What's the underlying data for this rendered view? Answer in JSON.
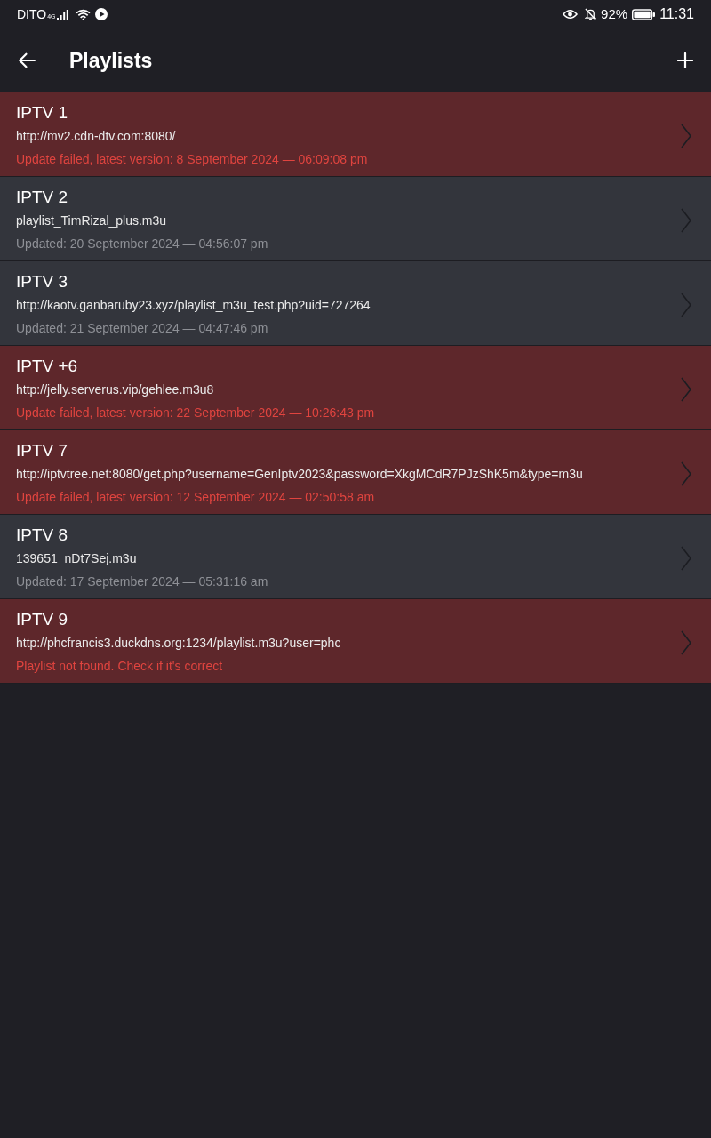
{
  "status_bar": {
    "carrier": "DITO",
    "network": "4G",
    "battery": "92%",
    "time": "11:31"
  },
  "app_bar": {
    "title": "Playlists"
  },
  "playlists": [
    {
      "name": "IPTV 1",
      "source": "http://mv2.cdn-dtv.com:8080/",
      "status": "Update failed, latest version: 8 September 2024 — 06:09:08 pm",
      "failed": true
    },
    {
      "name": "IPTV 2",
      "source": "playlist_TimRizal_plus.m3u",
      "status": "Updated: 20 September 2024 — 04:56:07 pm",
      "failed": false
    },
    {
      "name": "IPTV 3",
      "source": "http://kaotv.ganbaruby23.xyz/playlist_m3u_test.php?uid=727264",
      "status": "Updated: 21 September 2024 — 04:47:46 pm",
      "failed": false
    },
    {
      "name": "IPTV +6",
      "source": "http://jelly.serverus.vip/gehlee.m3u8",
      "status": "Update failed, latest version: 22 September 2024 — 10:26:43 pm",
      "failed": true
    },
    {
      "name": "IPTV 7",
      "source": "http://iptvtree.net:8080/get.php?username=GenIptv2023&password=XkgMCdR7PJzShK5m&type=m3u",
      "status": "Update failed, latest version: 12 September 2024 — 02:50:58 am",
      "failed": true
    },
    {
      "name": "IPTV 8",
      "source": "139651_nDt7Sej.m3u",
      "status": "Updated: 17 September 2024 — 05:31:16 am",
      "failed": false
    },
    {
      "name": "IPTV 9",
      "source": "http://phcfrancis3.duckdns.org:1234/playlist.m3u?user=phc",
      "status": "Playlist not found. Check if it's correct",
      "failed": true
    }
  ]
}
